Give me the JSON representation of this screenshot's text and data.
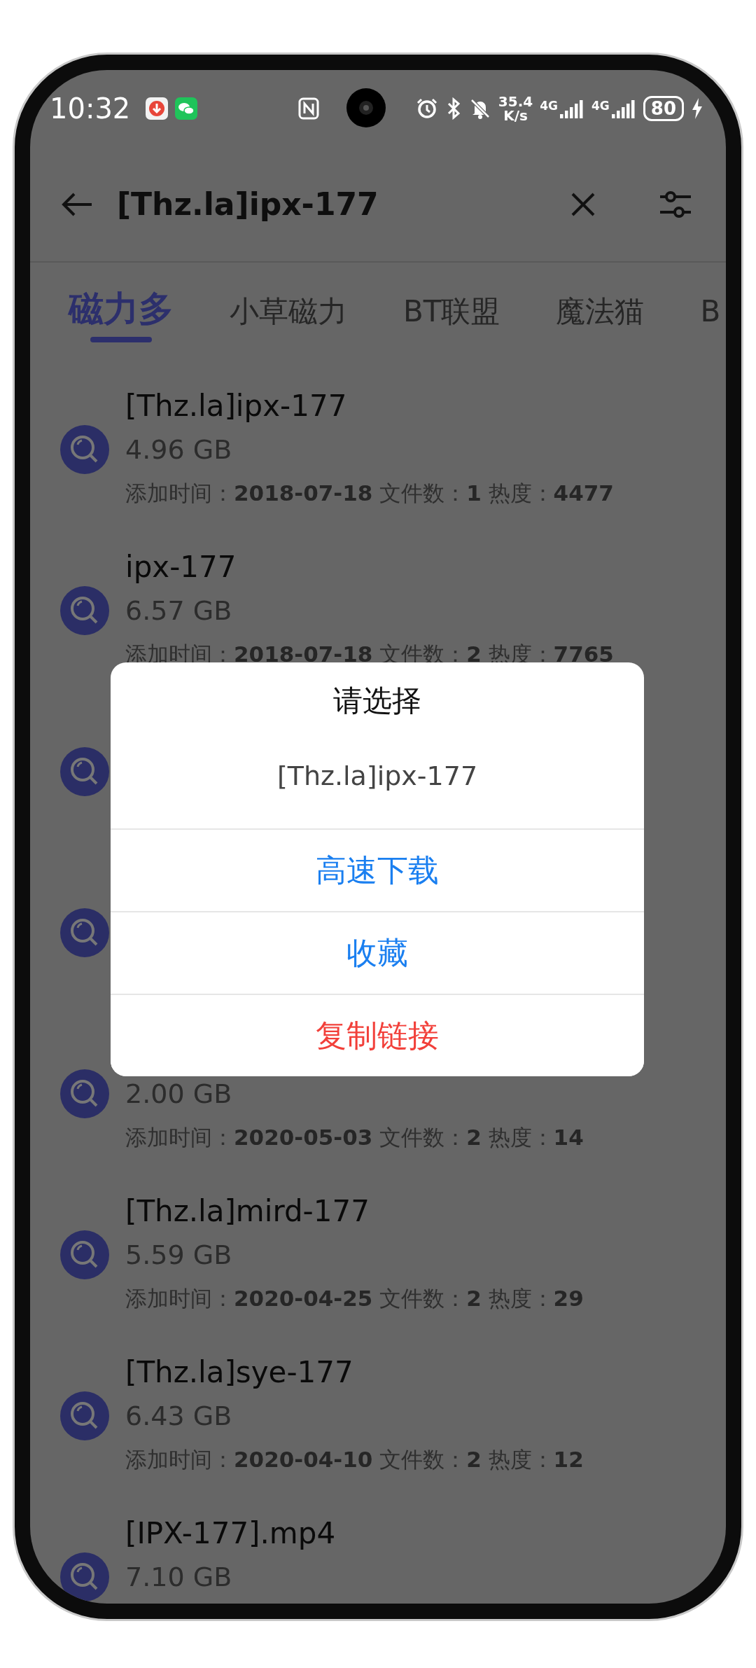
{
  "status_bar": {
    "time": "10:32",
    "speed_value": "35.4",
    "speed_unit": "K/s",
    "networks": [
      "4G",
      "4G"
    ],
    "battery": "80"
  },
  "search_bar": {
    "query": "[Thz.la]ipx-177"
  },
  "tabs": [
    {
      "label": "磁力多",
      "selected": true
    },
    {
      "label": "小草磁力",
      "selected": false
    },
    {
      "label": "BT联盟",
      "selected": false
    },
    {
      "label": "魔法猫",
      "selected": false
    },
    {
      "label": "B",
      "selected": false
    }
  ],
  "results": [
    {
      "kind": "result",
      "name": "[Thz.la]ipx-177",
      "size": "4.96 GB",
      "meta": "添加时间：**2018-07-18**  文件数：**1**  热度：**4477**"
    },
    {
      "kind": "result",
      "name": "ipx-177",
      "size": "6.57 GB",
      "meta": "添加时间：**2018-07-18**  文件数：**2**  热度：**7765**"
    },
    {
      "kind": "covered"
    },
    {
      "kind": "covered"
    },
    {
      "kind": "result",
      "size": "2.00 GB",
      "meta": "添加时间：**2020-05-03**  文件数：**2**  热度：**14**"
    },
    {
      "kind": "result",
      "name": "[Thz.la]mird-177",
      "size": "5.59 GB",
      "meta": "添加时间：**2020-04-25**  文件数：**2**  热度：**29**"
    },
    {
      "kind": "result",
      "name": "[Thz.la]sye-177",
      "size": "6.43 GB",
      "meta": "添加时间：**2020-04-10**  文件数：**2**  热度：**12**"
    },
    {
      "kind": "result",
      "name": "[IPX-177].mp4",
      "size": "7.10 GB"
    }
  ],
  "dialog": {
    "title": "请选择",
    "subtitle": "[Thz.la]ipx-177",
    "options": [
      {
        "label": "高速下载",
        "kind": "normal"
      },
      {
        "label": "收藏",
        "kind": "normal"
      },
      {
        "label": "复制链接",
        "kind": "destructive"
      }
    ]
  }
}
